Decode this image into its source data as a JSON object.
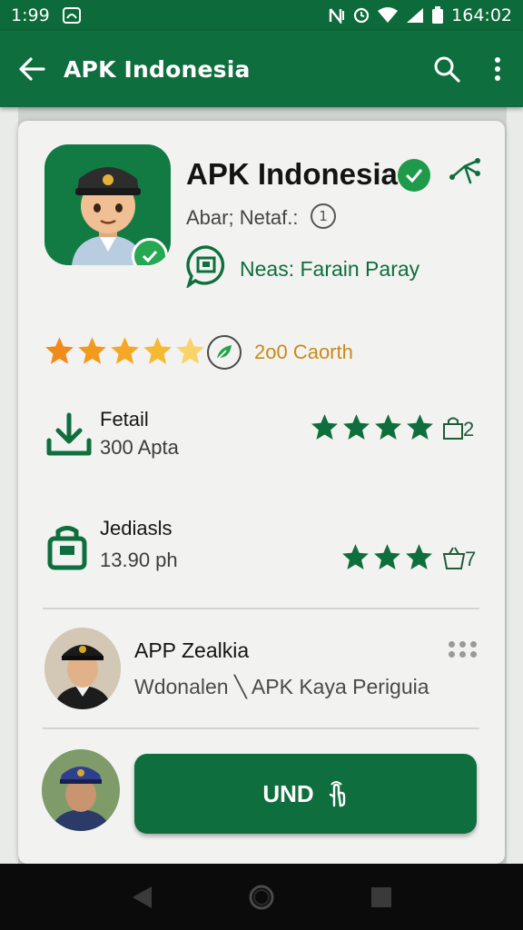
{
  "status_bar": {
    "time_left": "1:99",
    "time_right": "164:02",
    "icons": [
      "notification-icon",
      "nfc-icon",
      "alarm-icon",
      "wifi-icon",
      "signal-icon",
      "battery-icon"
    ]
  },
  "app_bar": {
    "title": "APK Indonesia",
    "icons": [
      "back-arrow-icon",
      "search-icon",
      "more-vert-icon"
    ]
  },
  "app": {
    "name": "APK Indonesia",
    "subtitle": "Abar; Netaf.:",
    "info_glyph": "1",
    "news_label": "Neas: Farain Paray",
    "rating_label": "2o0 Caorth",
    "rating_value": 4.5,
    "rating_max": 5
  },
  "stats": [
    {
      "title": "Fetail",
      "value": "300 Apta",
      "stars": 4,
      "badge_num": "2",
      "icon": "download-icon"
    },
    {
      "title": "Jediasls",
      "value": "13.90 ph",
      "stars": 3,
      "badge_num": "7",
      "icon": "briefcase-icon"
    }
  ],
  "developer": {
    "name": "APP Zealkia",
    "description": "Wdonalen ╲ APK Kaya Periguia"
  },
  "install_button": {
    "label": "UND"
  },
  "colors": {
    "primary": "#0f6e3d",
    "accent_green": "#1e9a4a",
    "star_orange": "#f0a020",
    "rating_text": "#c98a18",
    "navbar": "#0b0b0b"
  }
}
